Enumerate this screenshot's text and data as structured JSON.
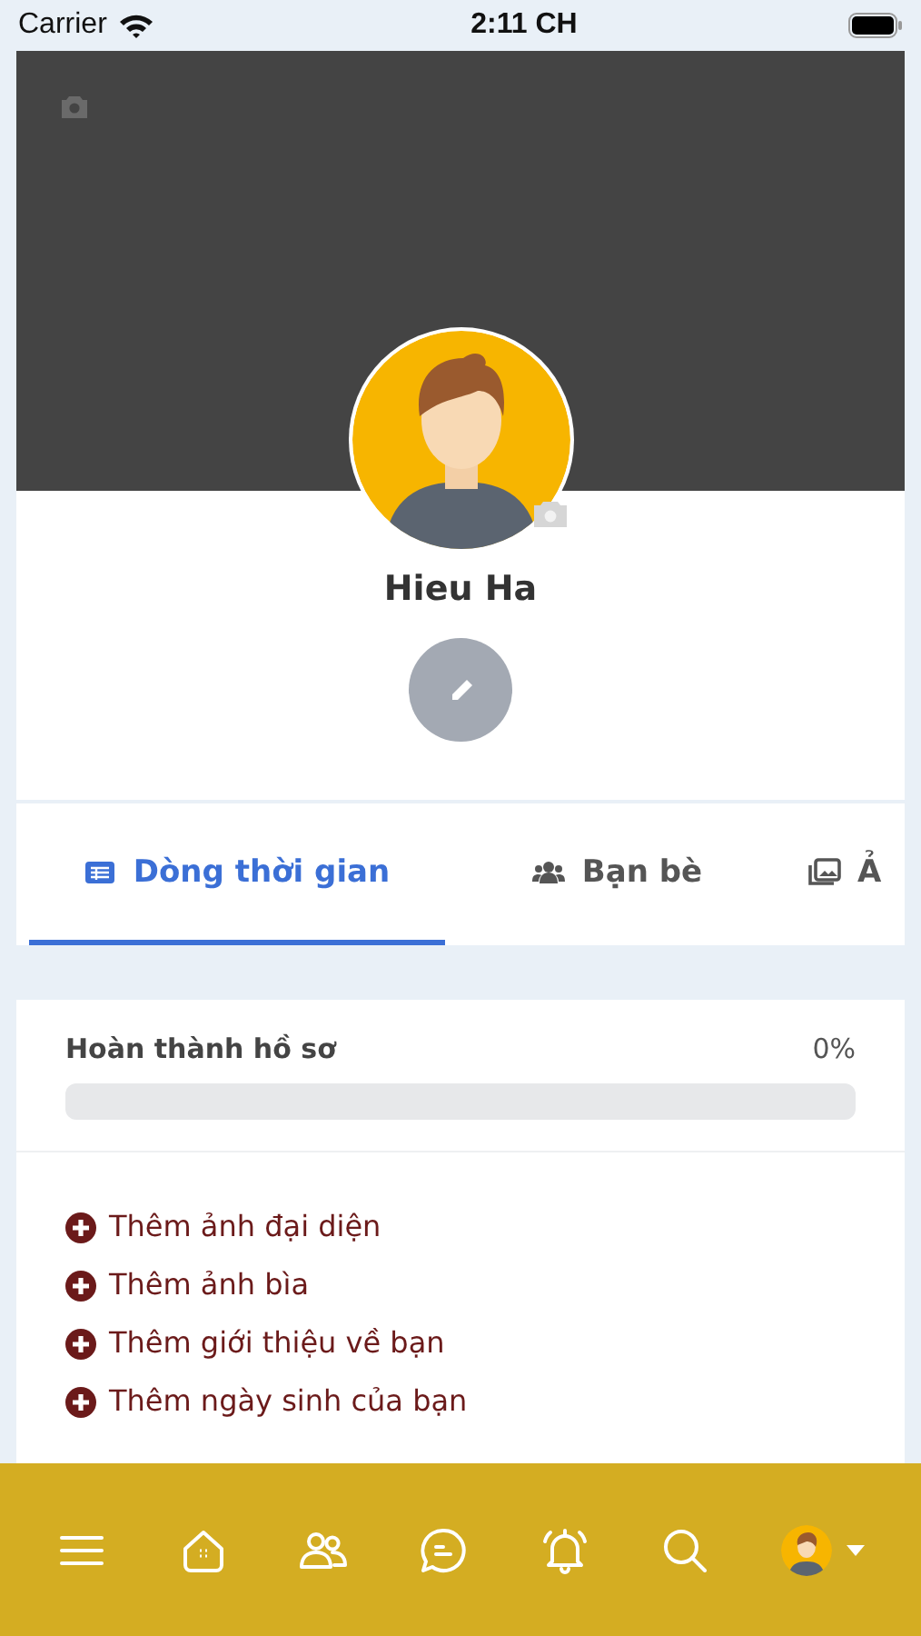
{
  "status_bar": {
    "carrier": "Carrier",
    "time": "2:11 CH"
  },
  "profile": {
    "name": "Hieu Ha"
  },
  "tabs": [
    {
      "label": "Dòng thời gian",
      "selected": true
    },
    {
      "label": "Bạn bè",
      "selected": false
    },
    {
      "label": "Ả",
      "selected": false
    }
  ],
  "completion": {
    "title": "Hoàn thành hồ sơ",
    "percent": "0%",
    "level": 0,
    "items": [
      "Thêm ảnh đại diện",
      "Thêm ảnh bìa",
      "Thêm giới thiệu về bạn",
      "Thêm ngày sinh của bạn"
    ]
  },
  "bottom_nav": [
    {
      "kind": "menu"
    },
    {
      "kind": "home"
    },
    {
      "kind": "friends"
    },
    {
      "kind": "messages"
    },
    {
      "kind": "notifications"
    },
    {
      "kind": "search"
    },
    {
      "kind": "account"
    }
  ]
}
